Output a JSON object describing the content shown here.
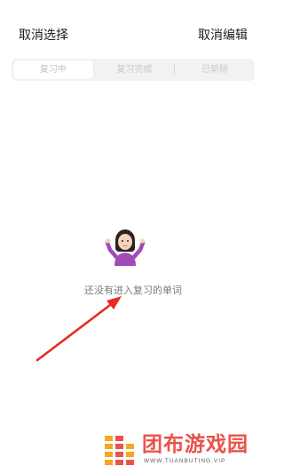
{
  "header": {
    "left_label": "取消选择",
    "right_label": "取消编辑"
  },
  "tabs": [
    {
      "label": "复习中",
      "active": true
    },
    {
      "label": "复习完成",
      "active": false
    },
    {
      "label": "已斩除",
      "active": false
    }
  ],
  "empty_state": {
    "icon": "person-shrugging-emoji-icon",
    "text": "还没有进入复习的单词"
  },
  "annotation": {
    "icon": "red-arrow-icon",
    "color": "#e62c24"
  },
  "watermark": {
    "brand_cn": "团布游戏园",
    "brand_en": "WWW.TUANBUTING.VIP",
    "colors": [
      "#f5a623",
      "#e9534b"
    ]
  }
}
